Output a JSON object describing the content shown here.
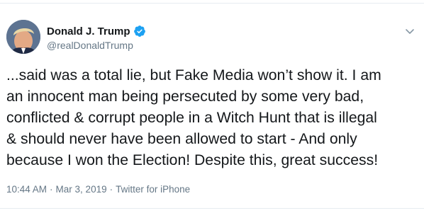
{
  "author": {
    "display_name": "Donald J. Trump",
    "handle": "@realDonaldTrump",
    "verified": true
  },
  "tweet": {
    "lines": [
      "...said was a total lie, but Fake Media won’t show it. I am",
      "an innocent man being persecuted by some very bad,",
      "conflicted & corrupt people in a Witch Hunt that is illegal",
      "& should never have been allowed to start - And only",
      "because I won the Election! Despite this, great success!"
    ]
  },
  "meta": {
    "time": "10:44 AM",
    "separator": "·",
    "date": "Mar 3, 2019",
    "source": "Twitter for iPhone"
  },
  "icons": {
    "verified": "verified-badge-icon",
    "caret": "chevron-down-icon"
  },
  "colors": {
    "text_primary": "#14171a",
    "text_secondary": "#657786",
    "verified_blue": "#1da1f2",
    "divider": "#e6ecf0"
  }
}
